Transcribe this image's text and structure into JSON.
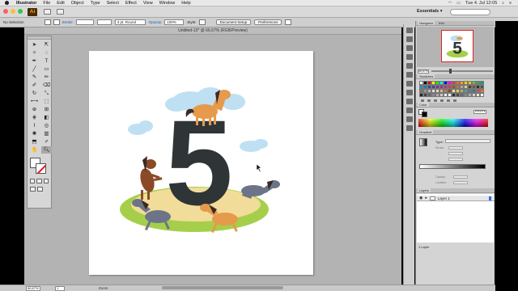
{
  "menubar": {
    "app_name": "Illustrator",
    "items": [
      "File",
      "Edit",
      "Object",
      "Type",
      "Select",
      "Effect",
      "View",
      "Window",
      "Help"
    ],
    "clock": "Tue 4. Jul  12:05",
    "icons": [
      "apple-icon",
      "wifi-icon",
      "battery-icon",
      "search-icon",
      "menu-icon"
    ]
  },
  "appbar": {
    "logo": "Ai",
    "workspace": "Essentials",
    "traffic_colors": [
      "#fc605c",
      "#fdbc40",
      "#34c84a"
    ]
  },
  "control_bar": {
    "selection": "No Selection",
    "stroke_label": "Stroke:",
    "stroke_profile": "3 pt. Round",
    "opacity_label": "Opacity:",
    "opacity_value": "100%",
    "style_label": "Style:",
    "doc_setup": "Document Setup",
    "preferences": "Preferences"
  },
  "document": {
    "tab_title": "Untitled-13* @ 66,67% (RGB/Preview)"
  },
  "artwork": {
    "numeral": "5",
    "colors": {
      "numeral": "#2f3436",
      "sky": "#bfe0f2",
      "grass": "#a5cf4a",
      "ground": "#f2dc9a",
      "horse_orange": "#e59a4c",
      "horse_brown": "#8b4a26",
      "horse_gray": "#6d7488",
      "mane_dark": "#3a2a24"
    }
  },
  "status_bar": {
    "zoom": "66,67%",
    "page": "1",
    "tool": "Zoom"
  },
  "panels": {
    "navigator": {
      "tab1": "Navigator",
      "tab2": "Info",
      "zoom": "66,67%"
    },
    "swatches": {
      "title": "Swatches"
    },
    "color": {
      "title": "Color",
      "hex": "FFFFFF"
    },
    "gradient": {
      "title": "Gradient",
      "type_label": "Type:",
      "stroke_label": "Stroke:",
      "opacity_label": "Opacity:",
      "location_label": "Location:"
    },
    "layers": {
      "title": "Layers",
      "layer_name": "Layer 1",
      "count": "1 Layer"
    }
  },
  "swatch_colors": [
    "#ffffff",
    "#000000",
    "#ff0000",
    "#ffff00",
    "#00ff00",
    "#00ffff",
    "#0000ff",
    "#ff00ff",
    "#e83a30",
    "#f26a2c",
    "#f7a01c",
    "#fcd20d",
    "#c5d92b",
    "#6cbf4a",
    "#35a853",
    "#1a9c7a",
    "#1b9bb3",
    "#1f79c0",
    "#2a4ea3",
    "#4b3c97",
    "#753596",
    "#9e2f8e",
    "#c72e76",
    "#e63154",
    "#8a5a2b",
    "#a67c52",
    "#c9a27a",
    "#e0c9a8",
    "#5c3d1e",
    "#7d5535",
    "#333333",
    "#555555",
    "#777777",
    "#999999",
    "#bbbbbb",
    "#dddddd",
    "#f0d1b8",
    "#e8b088",
    "#b87a4b",
    "#7b4a2a",
    "#fbe38a",
    "#f9c74f",
    "#90be6d",
    "#43aa8b",
    "#577590",
    "#277da1",
    "#f94144",
    "#f3722c",
    "#222222",
    "#444444",
    "#666666",
    "#888888",
    "#aaaaaa",
    "#cccccc",
    "#eeeeee",
    "#ffffff",
    "#2e2e2e",
    "#4a4a4a",
    "#6a6a6a",
    "#8a8a8a",
    "#aeaeae",
    "#cecece",
    "#e6e6e6",
    "#f6f6f6"
  ]
}
